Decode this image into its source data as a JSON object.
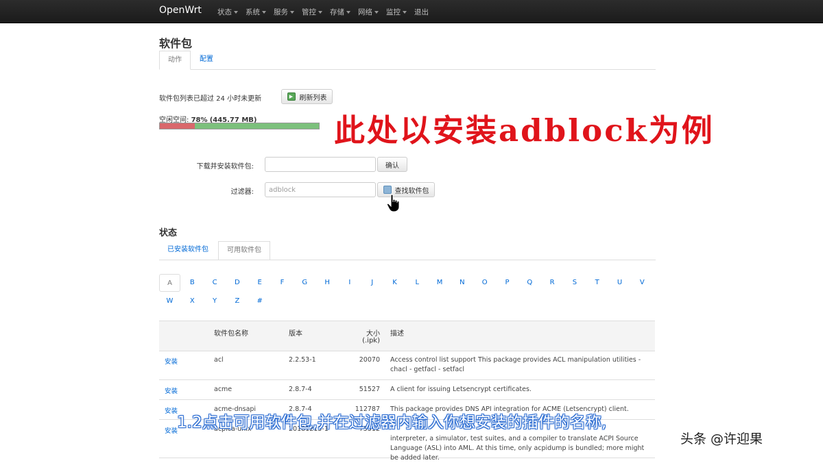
{
  "navbar": {
    "brand": "OpenWrt",
    "menu": [
      "状态",
      "系统",
      "服务",
      "管控",
      "存储",
      "网络",
      "监控",
      "退出"
    ]
  },
  "page": {
    "title": "软件包",
    "tabs": [
      "动作",
      "配置"
    ]
  },
  "actions": {
    "list_status": "软件包列表已超过 24 小时未更新",
    "refresh_button": "刷新列表",
    "free_space_label": "空闲空间:",
    "free_space_percent": "78%",
    "free_space_size": "(445.77 MB)",
    "used_fraction": 0.22,
    "download_label": "下载并安装软件包:",
    "download_value": "",
    "confirm_button": "确认",
    "filter_label": "过滤器:",
    "filter_value": "adblock",
    "find_button": "查找软件包"
  },
  "status": {
    "title": "状态",
    "tabs": [
      "已安装软件包",
      "可用软件包"
    ]
  },
  "letters": [
    "A",
    "B",
    "C",
    "D",
    "E",
    "F",
    "G",
    "H",
    "I",
    "J",
    "K",
    "L",
    "M",
    "N",
    "O",
    "P",
    "Q",
    "R",
    "S",
    "T",
    "U",
    "V",
    "W",
    "X",
    "Y",
    "Z",
    "#"
  ],
  "table": {
    "headers": {
      "name": "软件包名称",
      "version": "版本",
      "size": "大小",
      "size_unit": "(.ipk)",
      "desc": "描述"
    },
    "rows": [
      {
        "action": "安装",
        "name": "acl",
        "version": "2.2.53-1",
        "size": "20070",
        "desc": "Access control list support This package provides ACL manipulation utilities - chacl - getfacl - setfacl"
      },
      {
        "action": "安装",
        "name": "acme",
        "version": "2.8.7-4",
        "size": "51527",
        "desc": "A client for issuing Letsencrypt certificates."
      },
      {
        "action": "安装",
        "name": "acme-dnsapi",
        "version": "2.8.7-4",
        "size": "112787",
        "desc": "This package provides DNS API integration for ACME (Letsencrypt) client."
      },
      {
        "action": "安装",
        "name": "acpica-unix",
        "version": "20181213-1",
        "size": "75512",
        "desc": "interpreter, a simulator, test suites, and a compiler to translate ACPI Source Language (ASL) into AML. At this time, only acpidump is bundled; more might be added later."
      }
    ]
  },
  "annotation": "此处以安装adblock为例",
  "subtitle": "1.2点击可用软件包,并在过滤器内输入你想安装的插件的名称,",
  "watermark": "头条 @许迎果",
  "colors": {
    "accent": "#0069d6",
    "used_bar": "#d9676b",
    "free_bar": "#7cc07c",
    "annotation": "#e0141b"
  }
}
